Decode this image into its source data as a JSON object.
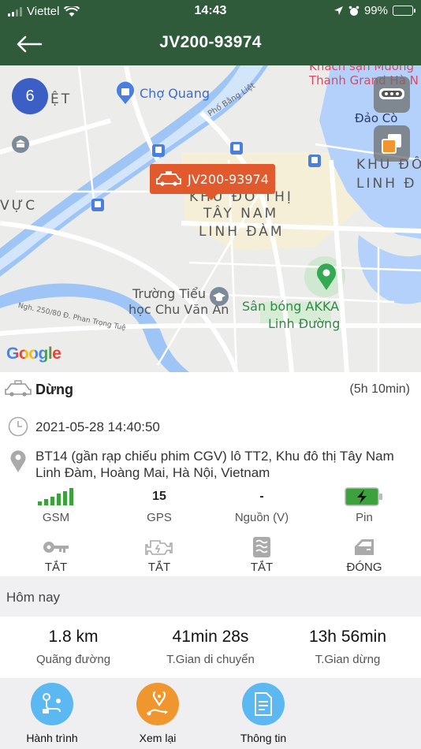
{
  "status_bar": {
    "carrier": "Viettel",
    "time": "14:43",
    "battery": "99%"
  },
  "header": {
    "title": "JV200-93974"
  },
  "map": {
    "cluster_count": "6",
    "vehicle_label": "JV200-93974",
    "attribution": "Google",
    "places": {
      "cho_quang": "Chợ Quang",
      "hotel_line1": "Khách sạn Mường",
      "hotel_line2": "Thanh Grand Hà N",
      "dao_co": "Đảo Cò",
      "district_tay_nam_1": "KHU ĐÔ THỊ",
      "district_tay_nam_2": "TÂY NAM",
      "district_tay_nam_3": "LINH ĐÀM",
      "district_right_1": "KHU ĐÔ",
      "district_right_2": "LINH Đ",
      "viet": "IỆT",
      "vuc": "VỰC",
      "street_bang_liet": "Phố Bằng Liệt",
      "street_phan_trong_tue": "Ngh. 250/80 Đ. Phan Trọng Tuệ",
      "school_1": "Trường Tiểu",
      "school_2": "học Chu Văn An",
      "stadium_1": "Sân bóng AKKA",
      "stadium_2": "Linh Đường"
    }
  },
  "vehicle": {
    "state": "Dừng",
    "duration": "(5h 10min)",
    "timestamp": "2021-05-28 14:40:50",
    "address": "BT14 (gần rạp chiếu phim CGV) lô TT2, Khu đô thị Tây Nam Linh Đàm, Hoàng Mai, Hà Nội, Vietnam"
  },
  "stats": [
    {
      "label": "GSM",
      "value": ""
    },
    {
      "label": "GPS",
      "value": "15"
    },
    {
      "label": "Nguồn (V)",
      "value": "-"
    },
    {
      "label": "Pin",
      "value": ""
    }
  ],
  "sensors": [
    {
      "label": "TẮT",
      "icon": "key-icon"
    },
    {
      "label": "TẮT",
      "icon": "engine-icon"
    },
    {
      "label": "TẮT",
      "icon": "air-conditioner-icon"
    },
    {
      "label": "ĐÓNG",
      "icon": "car-door-icon"
    }
  ],
  "today": {
    "header": "Hôm nay",
    "items": [
      {
        "value": "1.8 km",
        "label": "Quãng đường"
      },
      {
        "value": "41min 28s",
        "label": "T.Gian di chuyển"
      },
      {
        "value": "13h 56min",
        "label": "T.Gian dừng"
      }
    ]
  },
  "bottom_nav": [
    {
      "label": "Hành trình",
      "color": "#5bb8f0"
    },
    {
      "label": "Xem lại",
      "color": "#f0962e"
    },
    {
      "label": "Thông tin",
      "color": "#5bb8f0"
    }
  ],
  "colors": {
    "header": "#2f5b3a",
    "marker": "#e05a2e",
    "cluster": "#3b5fc4",
    "gsm": "#3da13d"
  }
}
